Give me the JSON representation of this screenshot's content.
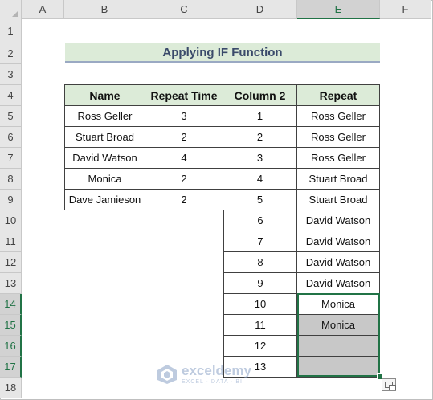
{
  "sheet": {
    "columns": [
      "A",
      "B",
      "C",
      "D",
      "E",
      "F"
    ],
    "rows": [
      "1",
      "2",
      "3",
      "4",
      "5",
      "6",
      "7",
      "8",
      "9",
      "10",
      "11",
      "12",
      "13",
      "14",
      "15",
      "16",
      "17",
      "18"
    ],
    "selected_column": "E",
    "selected_rows": [
      "14",
      "15",
      "16",
      "17"
    ]
  },
  "title": "Applying IF Function",
  "table": {
    "headers": [
      "Name",
      "Repeat Time",
      "Column 2",
      "Repeat"
    ],
    "names": [
      {
        "name": "Ross Geller",
        "repeat": "3"
      },
      {
        "name": "Stuart Broad",
        "repeat": "2"
      },
      {
        "name": "David Watson",
        "repeat": "4"
      },
      {
        "name": "Monica",
        "repeat": "2"
      },
      {
        "name": "Dave Jamieson",
        "repeat": "2"
      }
    ],
    "output": [
      {
        "col2": "1",
        "repeat": "Ross Geller"
      },
      {
        "col2": "2",
        "repeat": "Ross Geller"
      },
      {
        "col2": "3",
        "repeat": "Ross Geller"
      },
      {
        "col2": "4",
        "repeat": "Stuart Broad"
      },
      {
        "col2": "5",
        "repeat": "Stuart Broad"
      },
      {
        "col2": "6",
        "repeat": "David Watson"
      },
      {
        "col2": "7",
        "repeat": "David Watson"
      },
      {
        "col2": "8",
        "repeat": "David Watson"
      },
      {
        "col2": "9",
        "repeat": "David Watson"
      },
      {
        "col2": "10",
        "repeat": "Monica"
      },
      {
        "col2": "11",
        "repeat": "Monica"
      },
      {
        "col2": "12",
        "repeat": ""
      },
      {
        "col2": "13",
        "repeat": ""
      }
    ]
  },
  "watermark": {
    "name": "exceldemy",
    "tagline": "EXCEL · DATA · BI",
    "color": "#8aa2c6"
  },
  "colors": {
    "accent": "#217346",
    "header_fill": "#dcebd8",
    "selection_fill": "#c8c8c8"
  }
}
